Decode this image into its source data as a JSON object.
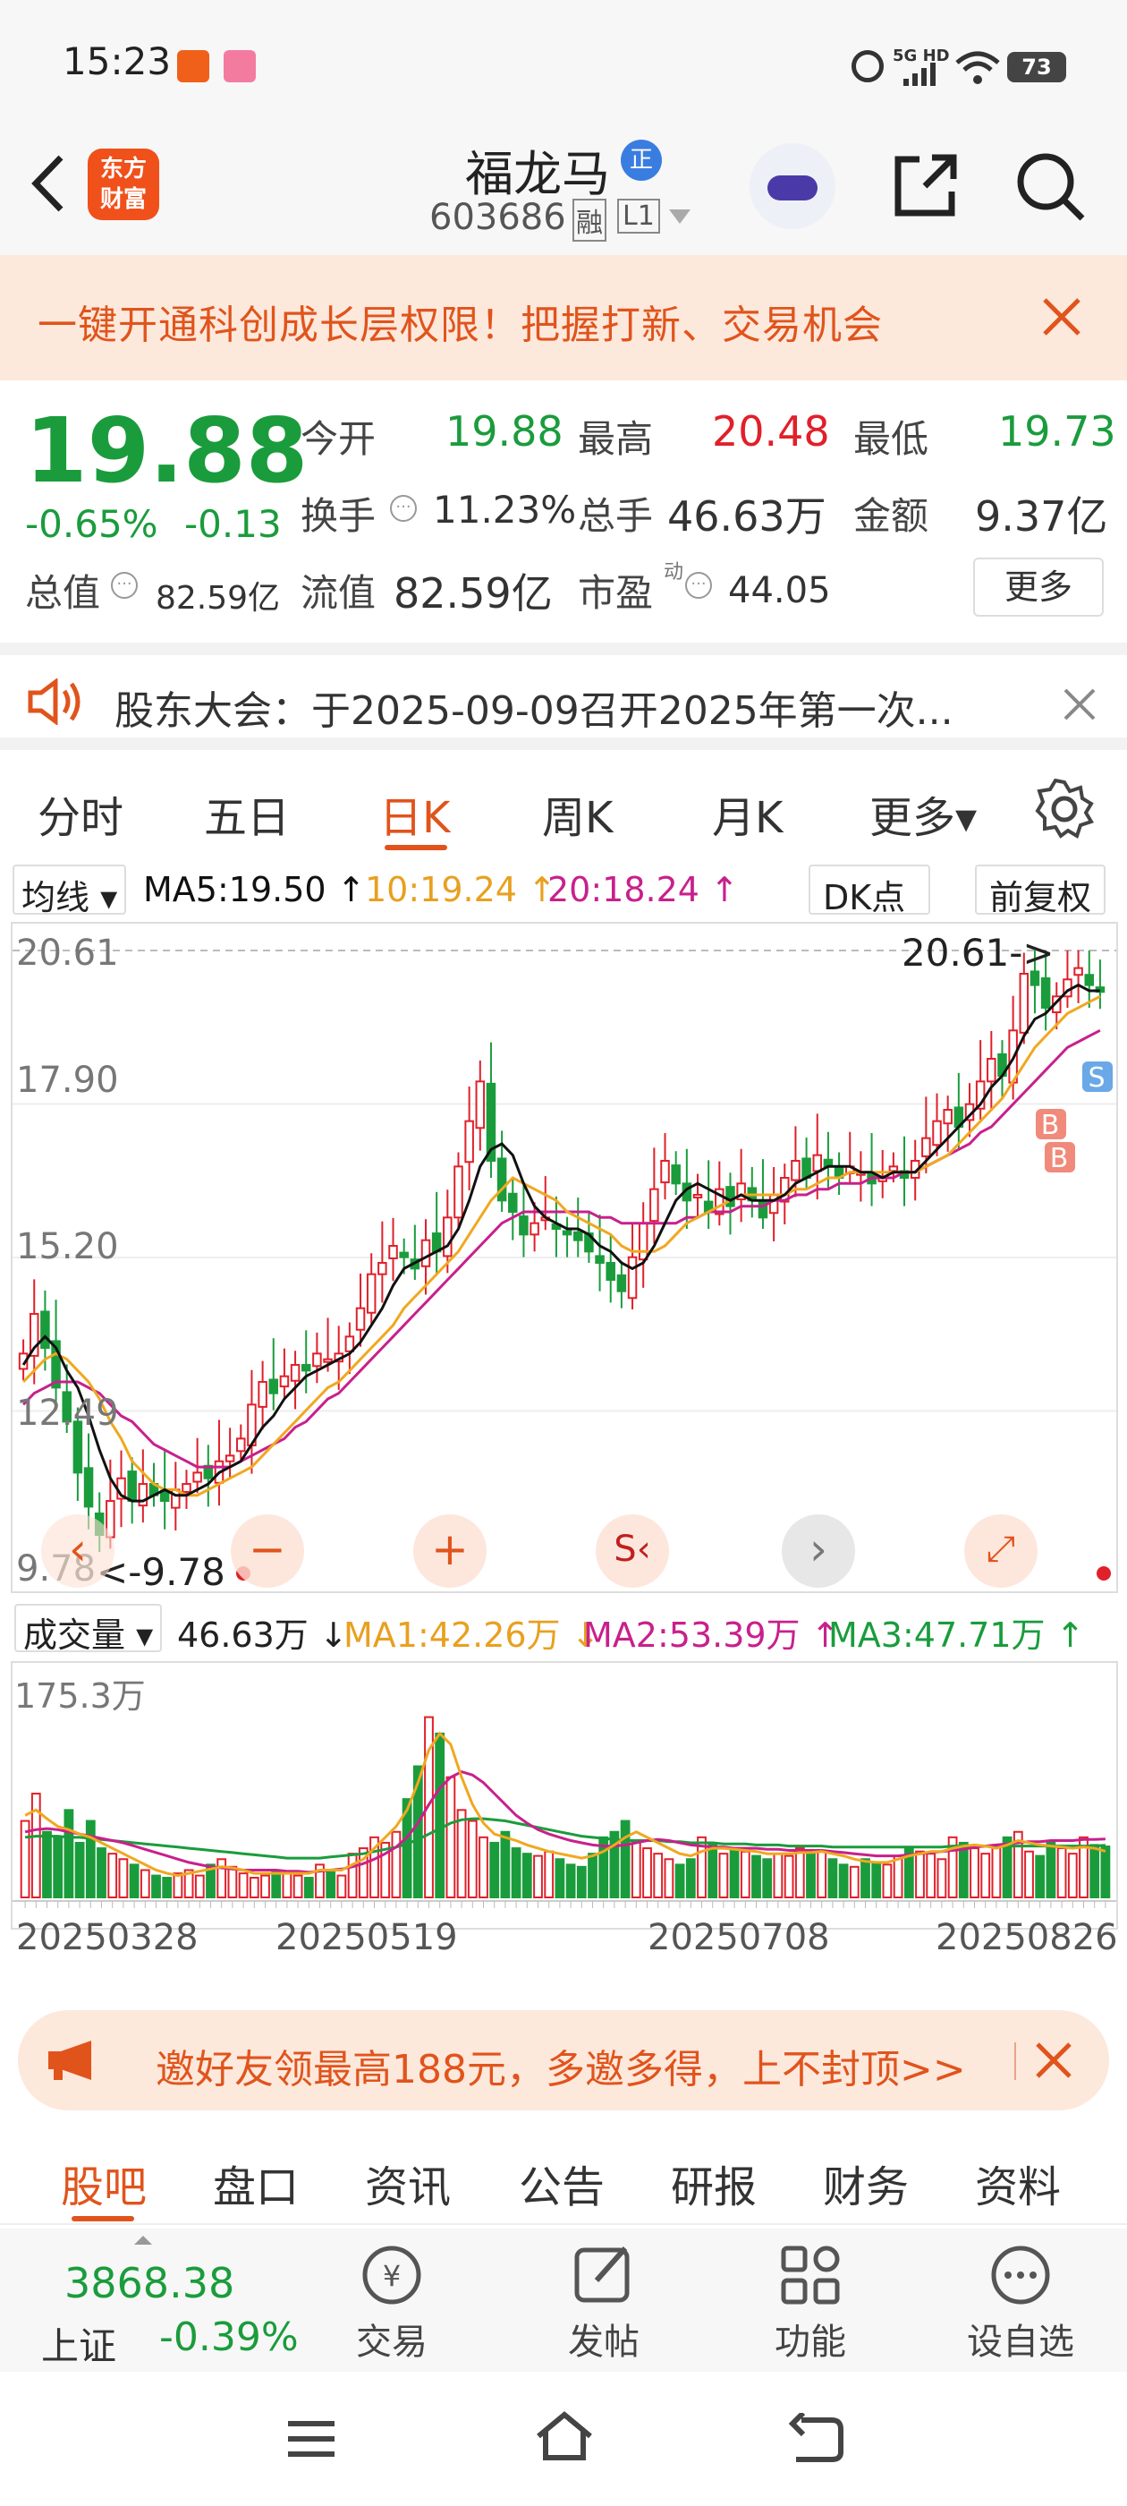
{
  "status_bar": {
    "time": "15:23",
    "network": "5G HD",
    "battery": "73"
  },
  "header": {
    "stock_name": "福龙马",
    "badge": "正",
    "stock_code": "603686",
    "tag_margin": "融",
    "tag_level": "L1",
    "brand_line1": "东方",
    "brand_line2": "财富"
  },
  "promo_banner": {
    "text": "一键开通科创成长层权限！把握打新、交易机会"
  },
  "quote": {
    "price": "19.88",
    "change_pct": "-0.65%",
    "change_amt": "-0.13",
    "open_label": "今开",
    "open": "19.88",
    "high_label": "最高",
    "high": "20.48",
    "low_label": "最低",
    "low": "19.73",
    "turnover_label": "换手",
    "turnover": "11.23%",
    "volume_label": "总手",
    "volume": "46.63万",
    "amount_label": "金额",
    "amount": "9.37亿",
    "mktcap_label": "总值",
    "mktcap": "82.59亿",
    "float_label": "流值",
    "float_cap": "82.59亿",
    "pe_label": "市盈",
    "pe_sup": "动",
    "pe": "44.05",
    "more_button": "更多"
  },
  "notice": {
    "text": "股东大会：于2025-09-09召开2025年第一次..."
  },
  "tabs": [
    {
      "label": "分时"
    },
    {
      "label": "五日"
    },
    {
      "label": "日K",
      "active": true
    },
    {
      "label": "周K"
    },
    {
      "label": "月K"
    },
    {
      "label": "更多▾"
    }
  ],
  "ma_line": {
    "selector": "均线",
    "ma5": "MA5:19.50 ↑",
    "ma10": "10:19.24 ↑",
    "ma20": "20:18.24 ↑",
    "dk": "DK点",
    "fq": "前复权"
  },
  "chart_data": [
    {
      "type": "candlestick",
      "y_ticks": [
        "20.61",
        "17.90",
        "15.20",
        "12.49",
        "9.78"
      ],
      "ylim": [
        9.78,
        20.61
      ],
      "max_label": "20.61->",
      "min_label": "<-9.78",
      "markers": [
        "B",
        "B",
        "S",
        "S"
      ],
      "x_labels": [
        "20250328",
        "20250519",
        "20250708",
        "20250826"
      ],
      "colors": {
        "up": "#e0202a",
        "down": "#1a9c3c",
        "ma5": "#111111",
        "ma10": "#f0a820",
        "ma20": "#c8208c"
      },
      "close": [
        13.5,
        14.2,
        13.6,
        12.9,
        12.3,
        11.4,
        10.8,
        10.3,
        10.9,
        11.3,
        10.9,
        11.2,
        11.0,
        10.9,
        11.1,
        11.2,
        11.4,
        11.3,
        11.6,
        11.7,
        12.0,
        12.6,
        13.0,
        12.8,
        13.1,
        13.3,
        13.2,
        13.5,
        13.4,
        13.5,
        13.8,
        14.3,
        14.9,
        15.1,
        15.4,
        15.2,
        15.0,
        15.5,
        15.3,
        15.9,
        16.8,
        17.6,
        18.3,
        16.9,
        16.2,
        16.0,
        15.6,
        15.8,
        15.9,
        15.7,
        15.6,
        15.5,
        15.3,
        15.1,
        14.8,
        14.6,
        15.2,
        15.8,
        16.4,
        16.9,
        16.5,
        16.2,
        16.3,
        16.0,
        16.4,
        16.1,
        16.5,
        16.2,
        15.9,
        16.3,
        16.6,
        16.9,
        16.6,
        17.0,
        16.8,
        16.6,
        16.8,
        16.7,
        16.5,
        16.6,
        16.8,
        16.6,
        16.9,
        17.3,
        17.6,
        17.8,
        17.5,
        17.9,
        18.3,
        18.7,
        18.4,
        19.2,
        20.2,
        20.0,
        19.6,
        19.8,
        20.1,
        20.3,
        20.0,
        19.88
      ],
      "ma5": [
        13.3,
        13.6,
        13.8,
        13.6,
        13.2,
        12.9,
        12.4,
        11.8,
        11.3,
        11.0,
        10.9,
        10.9,
        11.0,
        11.1,
        11.0,
        11.0,
        11.1,
        11.2,
        11.4,
        11.5,
        11.6,
        11.9,
        12.2,
        12.4,
        12.7,
        12.9,
        13.1,
        13.2,
        13.3,
        13.4,
        13.5,
        13.7,
        14.0,
        14.3,
        14.7,
        15.0,
        15.1,
        15.2,
        15.3,
        15.4,
        15.7,
        16.2,
        16.8,
        17.1,
        17.2,
        17.0,
        16.5,
        16.1,
        15.9,
        15.8,
        15.7,
        15.7,
        15.6,
        15.4,
        15.3,
        15.1,
        15.0,
        15.1,
        15.4,
        15.8,
        16.2,
        16.4,
        16.5,
        16.4,
        16.3,
        16.2,
        16.3,
        16.2,
        16.2,
        16.2,
        16.3,
        16.5,
        16.6,
        16.7,
        16.8,
        16.8,
        16.8,
        16.7,
        16.7,
        16.6,
        16.7,
        16.7,
        16.7,
        16.9,
        17.1,
        17.3,
        17.5,
        17.7,
        17.9,
        18.2,
        18.4,
        18.7,
        19.1,
        19.4,
        19.5,
        19.7,
        19.9,
        20.0,
        19.9,
        19.9
      ],
      "ma10": [
        13.0,
        13.2,
        13.4,
        13.5,
        13.4,
        13.2,
        13.0,
        12.7,
        12.3,
        12.0,
        11.6,
        11.4,
        11.2,
        11.1,
        11.1,
        11.0,
        11.0,
        11.1,
        11.2,
        11.3,
        11.4,
        11.5,
        11.7,
        11.9,
        12.1,
        12.3,
        12.5,
        12.7,
        12.9,
        13.0,
        13.2,
        13.4,
        13.6,
        13.8,
        14.0,
        14.3,
        14.5,
        14.7,
        14.9,
        15.1,
        15.3,
        15.6,
        15.9,
        16.2,
        16.4,
        16.6,
        16.5,
        16.4,
        16.3,
        16.2,
        16.0,
        15.9,
        15.8,
        15.7,
        15.6,
        15.4,
        15.3,
        15.3,
        15.3,
        15.4,
        15.6,
        15.8,
        15.9,
        16.0,
        16.1,
        16.2,
        16.3,
        16.3,
        16.3,
        16.3,
        16.3,
        16.4,
        16.4,
        16.5,
        16.6,
        16.6,
        16.7,
        16.7,
        16.7,
        16.7,
        16.7,
        16.7,
        16.7,
        16.8,
        16.9,
        17.0,
        17.2,
        17.4,
        17.6,
        17.8,
        18.0,
        18.3,
        18.6,
        18.9,
        19.1,
        19.3,
        19.5,
        19.6,
        19.7,
        19.8
      ],
      "ma20": [
        12.6,
        12.8,
        12.9,
        13.0,
        13.0,
        13.0,
        12.9,
        12.8,
        12.6,
        12.4,
        12.3,
        12.1,
        11.9,
        11.8,
        11.7,
        11.6,
        11.5,
        11.5,
        11.5,
        11.5,
        11.6,
        11.7,
        11.8,
        11.9,
        12.0,
        12.2,
        12.3,
        12.5,
        12.7,
        12.8,
        13.0,
        13.2,
        13.4,
        13.6,
        13.8,
        14.0,
        14.2,
        14.4,
        14.6,
        14.8,
        15.0,
        15.2,
        15.4,
        15.6,
        15.8,
        15.9,
        16.0,
        16.0,
        16.0,
        16.0,
        16.0,
        16.0,
        16.0,
        15.9,
        15.9,
        15.8,
        15.8,
        15.8,
        15.8,
        15.8,
        15.8,
        15.9,
        15.9,
        16.0,
        16.0,
        16.0,
        16.1,
        16.1,
        16.1,
        16.2,
        16.2,
        16.3,
        16.3,
        16.4,
        16.4,
        16.5,
        16.5,
        16.5,
        16.6,
        16.6,
        16.6,
        16.7,
        16.7,
        16.8,
        16.9,
        17.0,
        17.1,
        17.2,
        17.4,
        17.5,
        17.7,
        17.9,
        18.1,
        18.3,
        18.5,
        18.7,
        18.9,
        19.0,
        19.1,
        19.2
      ]
    },
    {
      "type": "bar",
      "title": "成交量",
      "y_ticks": [
        "175.3万"
      ],
      "ylim": [
        0,
        175.3
      ],
      "legend": {
        "vol": "46.63万 ↓",
        "ma1": "MA1:42.26万 ↓",
        "ma2": "MA2:53.39万 ↑",
        "ma3": "MA3:47.71万 ↑"
      },
      "colors": {
        "ma1": "#f0a820",
        "ma2": "#c8208c",
        "ma3": "#1a9c3c"
      },
      "values": [
        70,
        95,
        60,
        55,
        80,
        50,
        70,
        45,
        40,
        35,
        30,
        25,
        20,
        18,
        22,
        25,
        20,
        30,
        35,
        28,
        22,
        18,
        20,
        25,
        22,
        20,
        18,
        30,
        25,
        20,
        40,
        45,
        55,
        50,
        60,
        90,
        120,
        165,
        150,
        110,
        80,
        70,
        55,
        50,
        60,
        45,
        40,
        38,
        42,
        35,
        30,
        28,
        40,
        55,
        60,
        70,
        50,
        45,
        40,
        35,
        30,
        35,
        55,
        50,
        40,
        45,
        42,
        38,
        35,
        40,
        38,
        45,
        40,
        42,
        35,
        30,
        28,
        35,
        32,
        30,
        38,
        45,
        42,
        40,
        35,
        55,
        50,
        45,
        40,
        48,
        55,
        60,
        42,
        38,
        50,
        45,
        40,
        55,
        48,
        46.63
      ],
      "ma1": [
        75,
        80,
        72,
        65,
        62,
        58,
        55,
        50,
        45,
        40,
        35,
        30,
        25,
        22,
        20,
        22,
        24,
        26,
        28,
        27,
        25,
        22,
        22,
        22,
        22,
        22,
        22,
        25,
        25,
        25,
        30,
        35,
        45,
        55,
        65,
        80,
        105,
        135,
        150,
        140,
        110,
        85,
        68,
        58,
        55,
        52,
        48,
        45,
        42,
        40,
        38,
        36,
        38,
        42,
        48,
        55,
        60,
        55,
        50,
        45,
        40,
        38,
        42,
        45,
        45,
        44,
        43,
        42,
        40,
        40,
        40,
        41,
        41,
        42,
        40,
        38,
        35,
        33,
        32,
        32,
        35,
        38,
        40,
        42,
        42,
        45,
        47,
        48,
        47,
        45,
        48,
        52,
        50,
        48,
        47,
        46,
        45,
        46,
        45,
        42.26
      ],
      "ma2": [
        60,
        62,
        63,
        62,
        60,
        58,
        56,
        54,
        52,
        50,
        47,
        44,
        41,
        38,
        35,
        32,
        30,
        28,
        27,
        26,
        25,
        25,
        25,
        25,
        24,
        24,
        23,
        24,
        25,
        26,
        28,
        31,
        35,
        40,
        46,
        55,
        68,
        85,
        100,
        110,
        115,
        112,
        105,
        95,
        85,
        75,
        68,
        62,
        58,
        55,
        52,
        50,
        48,
        47,
        47,
        48,
        50,
        52,
        53,
        52,
        50,
        48,
        47,
        46,
        46,
        45,
        45,
        45,
        44,
        44,
        43,
        43,
        43,
        43,
        42,
        41,
        40,
        39,
        38,
        38,
        38,
        39,
        40,
        41,
        42,
        43,
        44,
        46,
        47,
        48,
        49,
        50,
        51,
        51,
        52,
        52,
        52,
        53,
        53,
        53.39
      ],
      "ma3": [
        55,
        56,
        56,
        56,
        55,
        55,
        54,
        53,
        52,
        51,
        50,
        49,
        48,
        47,
        46,
        45,
        44,
        43,
        42,
        41,
        40,
        39,
        38,
        37,
        36,
        36,
        36,
        36,
        37,
        38,
        39,
        40,
        42,
        44,
        46,
        49,
        53,
        58,
        63,
        68,
        71,
        72,
        72,
        71,
        70,
        68,
        66,
        64,
        62,
        60,
        58,
        56,
        55,
        54,
        53,
        52,
        52,
        52,
        52,
        51,
        51,
        50,
        50,
        50,
        49,
        49,
        49,
        48,
        48,
        48,
        47,
        47,
        47,
        47,
        46,
        46,
        46,
        46,
        46,
        46,
        46,
        46,
        46,
        46,
        46,
        47,
        47,
        47,
        47,
        47,
        47,
        47,
        47,
        47,
        47,
        47,
        47,
        47,
        47,
        47.71
      ]
    }
  ],
  "promo_banner2": {
    "text": "邀好友领最高188元，多邀多得，上不封顶>>"
  },
  "bottom_tabs": [
    {
      "label": "股吧",
      "active": true
    },
    {
      "label": "盘口"
    },
    {
      "label": "资讯"
    },
    {
      "label": "公告"
    },
    {
      "label": "研报"
    },
    {
      "label": "财务"
    },
    {
      "label": "资料"
    }
  ],
  "footer": {
    "index_value": "3868.38",
    "index_name": "上证",
    "index_change": "-0.39%",
    "trade": "交易",
    "post": "发帖",
    "functions": "功能",
    "watchlist": "设自选"
  }
}
